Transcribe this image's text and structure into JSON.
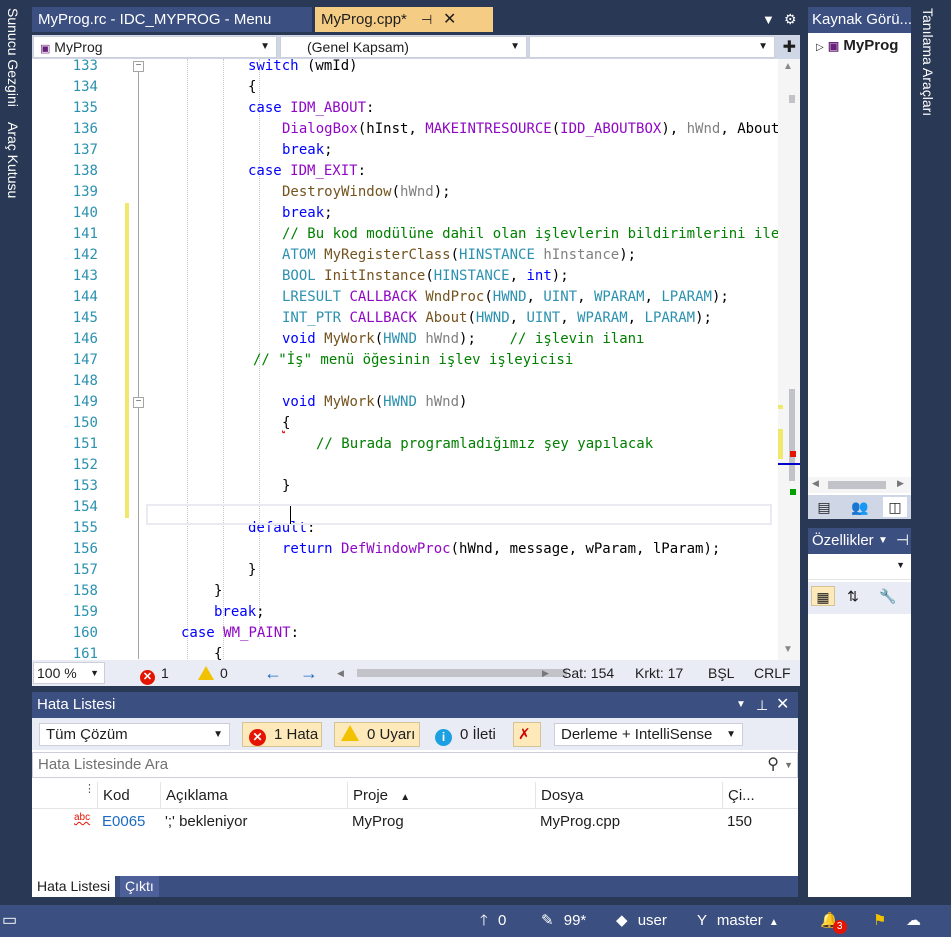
{
  "side_left": {
    "tab1": "Sunucu Gezgini",
    "tab2": "Araç Kutusu"
  },
  "side_right": {
    "tab1": "Tanılama Araçları"
  },
  "doc_tabs": [
    {
      "label": "MyProg.rc - IDC_MYPROG - Menu"
    },
    {
      "label": "MyProg.cpp*"
    }
  ],
  "navbar": {
    "project": "MyProg",
    "scope": "(Genel Kapsam)",
    "member": ""
  },
  "code_lines": [
    {
      "n": "133",
      "html": "<span class='kw'>switch</span> (wmId)",
      "indent": 6,
      "fold": true
    },
    {
      "n": "134",
      "html": "{",
      "indent": 6
    },
    {
      "n": "135",
      "html": "<span class='kw'>case</span> <span class='mac'>IDM_ABOUT</span>:",
      "indent": 6
    },
    {
      "n": "136",
      "html": "<span class='mac'>DialogBox</span>(hInst, <span class='mac'>MAKEINTRESOURCE</span>(<span class='mac'>IDD_ABOUTBOX</span>), <span class='prm'>hWnd</span>, About);",
      "indent": 8
    },
    {
      "n": "137",
      "html": "<span class='kw'>break</span>;",
      "indent": 8
    },
    {
      "n": "138",
      "html": "<span class='kw'>case</span> <span class='mac'>IDM_EXIT</span>:",
      "indent": 6
    },
    {
      "n": "139",
      "html": "<span class='fn'>DestroyWindow</span>(<span class='prm'>hWnd</span>);",
      "indent": 8
    },
    {
      "n": "140",
      "html": "<span class='kw'>break</span>;",
      "indent": 8,
      "changed": true
    },
    {
      "n": "141",
      "html": "<span class='cm'>// Bu kod modülüne dahil olan işlevlerin bildirimlerini iletin:</span>",
      "indent": 8,
      "changed": true
    },
    {
      "n": "142",
      "html": "<span class='ty'>ATOM</span> <span class='fn'>MyRegisterClass</span>(<span class='ty'>HINSTANCE</span> <span class='prm'>hInstance</span>);",
      "indent": 8,
      "changed": true
    },
    {
      "n": "143",
      "html": "<span class='ty'>BOOL</span> <span class='fn'>InitInstance</span>(<span class='ty'>HINSTANCE</span>, <span class='kw'>int</span>);",
      "indent": 8,
      "changed": true
    },
    {
      "n": "144",
      "html": "<span class='ty'>LRESULT</span> <span class='mac'>CALLBACK</span> <span class='fn'>WndProc</span>(<span class='ty'>HWND</span>, <span class='ty'>UINT</span>, <span class='ty'>WPARAM</span>, <span class='ty'>LPARAM</span>);",
      "indent": 8,
      "changed": true
    },
    {
      "n": "145",
      "html": "<span class='ty'>INT_PTR</span> <span class='mac'>CALLBACK</span> <span class='fn'>About</span>(<span class='ty'>HWND</span>, <span class='ty'>UINT</span>, <span class='ty'>WPARAM</span>, <span class='ty'>LPARAM</span>);",
      "indent": 8,
      "changed": true
    },
    {
      "n": "146",
      "html": "<span class='kw'>void</span> <span class='fn'>MyWork</span>(<span class='ty'>HWND</span> <span class='prm'>hWnd</span>);    <span class='cm'>// işlevin ilanı</span>",
      "indent": 8,
      "changed": true
    },
    {
      "n": "147",
      "html": "<span class='cm'>// \"İş\" menü öğesinin işlev işleyicisi</span>",
      "indent": 6.3,
      "changed": true
    },
    {
      "n": "148",
      "html": "",
      "indent": 8,
      "changed": true
    },
    {
      "n": "149",
      "html": "<span class='kw'>void</span> <span class='fn'>MyWork</span>(<span class='ty'>HWND</span> <span class='prm'>hWnd</span>)",
      "indent": 8,
      "changed": true,
      "fold": true
    },
    {
      "n": "150",
      "html": "<span class='err-sq'>{</span>",
      "indent": 8,
      "changed": true
    },
    {
      "n": "151",
      "html": "<span class='cm'>// Burada programladığımız şey yapılacak</span>",
      "indent": 10,
      "changed": true
    },
    {
      "n": "152",
      "html": "",
      "indent": 8,
      "changed": true
    },
    {
      "n": "153",
      "html": "}",
      "indent": 8,
      "changed": true
    },
    {
      "n": "154",
      "html": "",
      "indent": 8,
      "changed": true
    },
    {
      "n": "155",
      "html": "<span class='kw'>default</span>:",
      "indent": 6
    },
    {
      "n": "156",
      "html": "<span class='kw'>return</span> <span class='mac'>DefWindowProc</span>(hWnd, message, wParam, lParam);",
      "indent": 8
    },
    {
      "n": "157",
      "html": "}",
      "indent": 6
    },
    {
      "n": "158",
      "html": "}",
      "indent": 4
    },
    {
      "n": "159",
      "html": "<span class='kw'>break</span>;",
      "indent": 4
    },
    {
      "n": "160",
      "html": "<span class='kw'>case</span> <span class='mac'>WM_PAINT</span>:",
      "indent": 2
    },
    {
      "n": "161",
      "html": "{",
      "indent": 4
    }
  ],
  "editor_status": {
    "zoom": "100 %",
    "errors": "1",
    "warnings": "0",
    "line": "Sat: 154",
    "col": "Krkt: 17",
    "ins": "BŞL",
    "eol": "CRLF"
  },
  "error_list": {
    "title": "Hata Listesi",
    "scope": "Tüm Çözüm",
    "errors_btn": "1 Hata",
    "warnings_btn": "0 Uyarı",
    "messages_btn": "0 İleti",
    "source": "Derleme + IntelliSense",
    "search_placeholder": "Hata Listesinde Ara",
    "columns": [
      "Kod",
      "Açıklama",
      "Proje",
      "Dosya",
      "Çi..."
    ],
    "rows": [
      {
        "code": "E0065",
        "desc": "';' bekleniyor",
        "project": "MyProg",
        "file": "MyProg.cpp",
        "line": "150"
      }
    ],
    "tabs": [
      "Hata Listesi",
      "Çıktı"
    ]
  },
  "solution": {
    "title": "Kaynak Görü...",
    "item": "MyProg"
  },
  "properties": {
    "title": "Özellikler"
  },
  "statusbar": {
    "push": "0",
    "pending": "99*",
    "user": "user",
    "branch": "master",
    "notifications": "3"
  },
  "colors": {
    "accent": "#3b4f81",
    "active_tab": "#f5cc84",
    "error": "#e51400",
    "warning": "#f2c200"
  }
}
